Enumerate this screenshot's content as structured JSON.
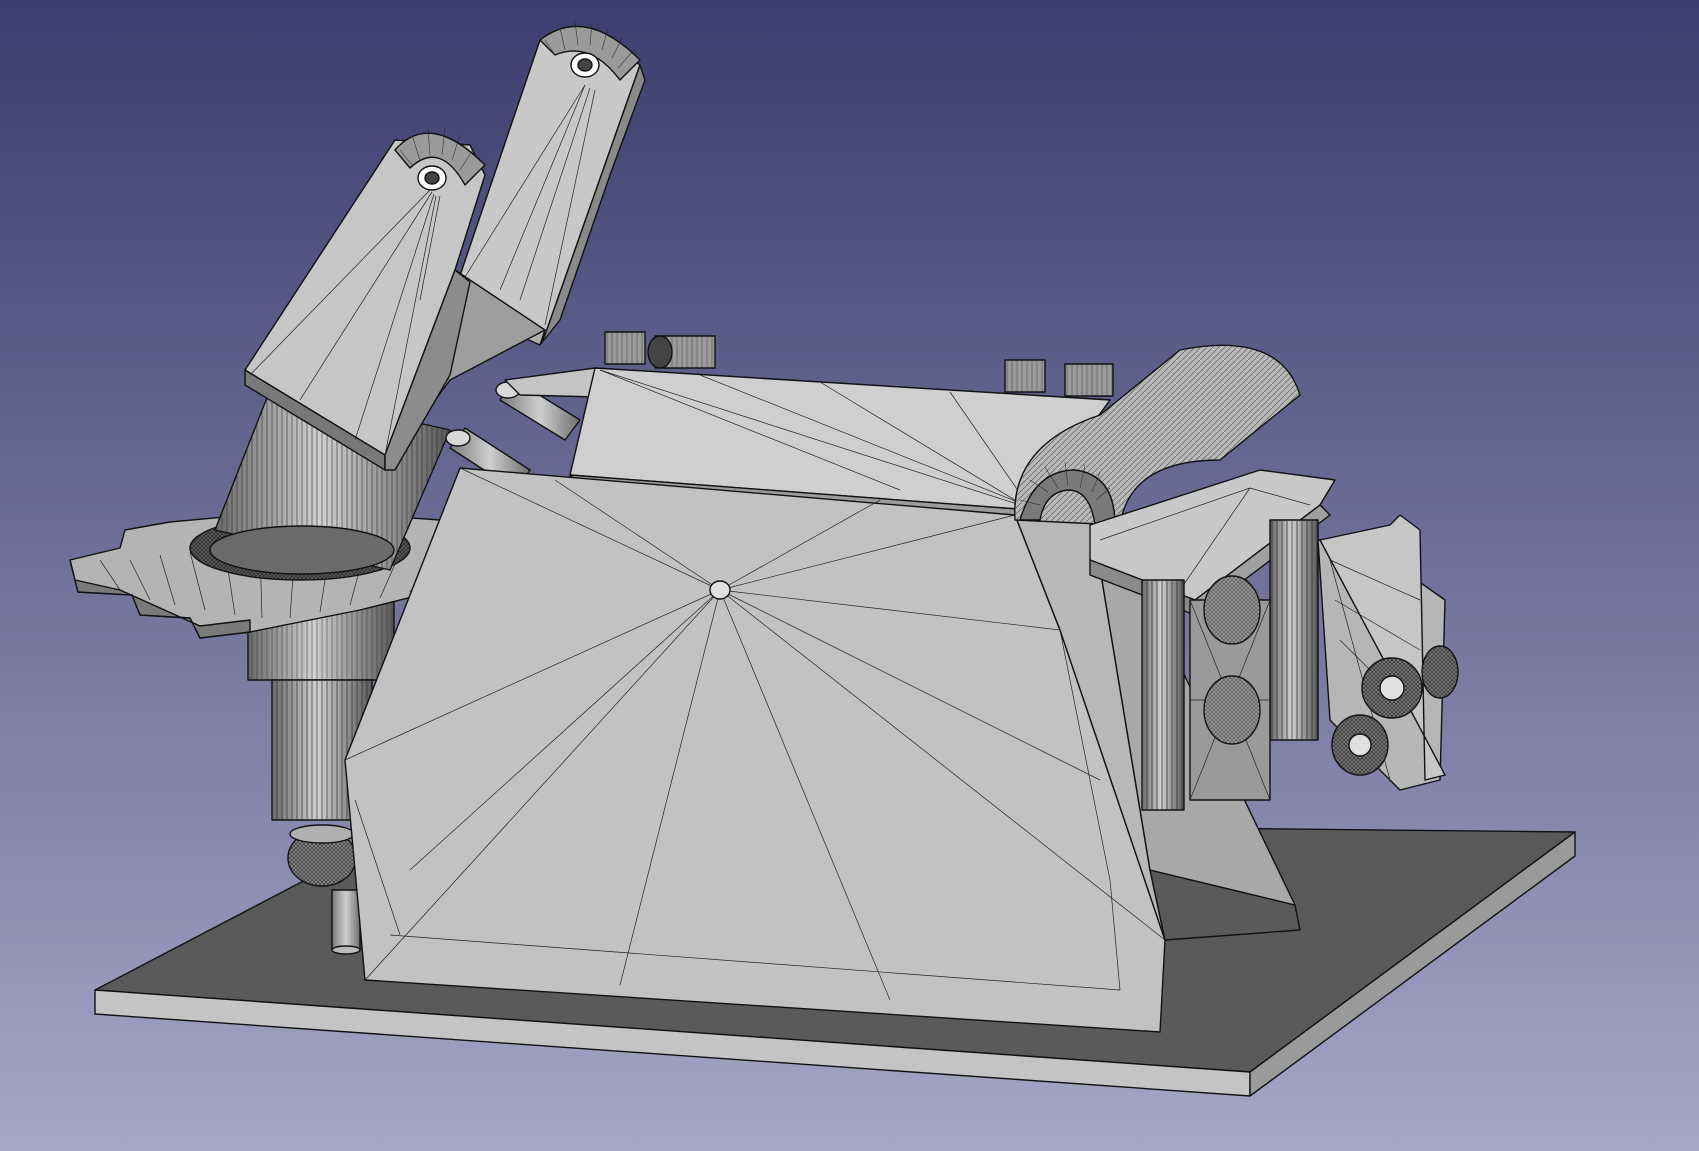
{
  "window": {
    "background_top": "#3c3c6e",
    "background_bottom": "#a6a6c8"
  },
  "scene": {
    "face_light": "#c8c8c8",
    "face_mid": "#a6a6a6",
    "face_dark": "#555555",
    "edge_color": "#111111"
  }
}
